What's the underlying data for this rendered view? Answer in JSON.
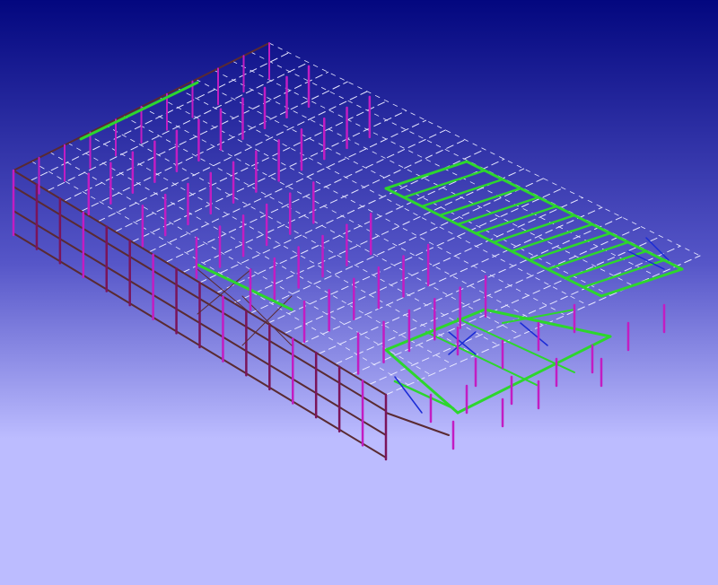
{
  "viewport": {
    "background_top": "#03077f",
    "background_bottom": "#bcbcff"
  },
  "model": {
    "colors": {
      "column": "#c21dc2",
      "column_dark": "#7a145a",
      "grid_line": "#e8e8ff",
      "beam_green": "#2dd62d",
      "beam_green_dark": "#0c7a0c",
      "frame_brown": "#5a2a32",
      "bracing_blue": "#1a2bd6",
      "purlin_white": "#ffffff"
    }
  }
}
